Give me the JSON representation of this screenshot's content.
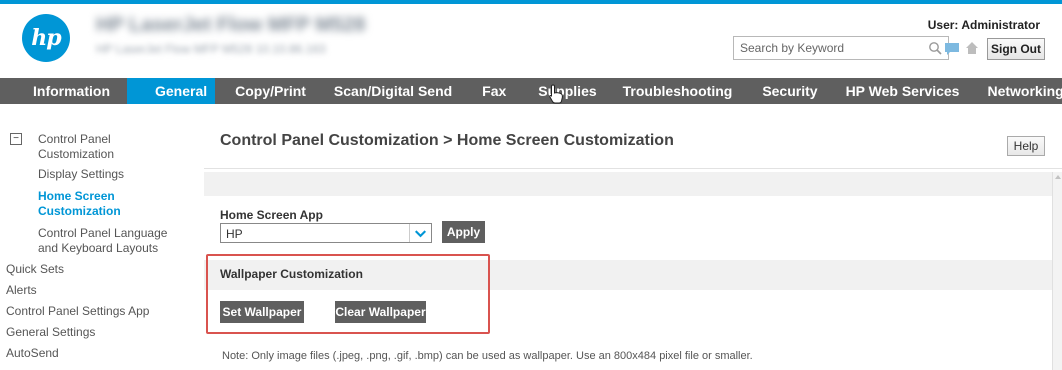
{
  "header": {
    "logo_text": "hp",
    "device_name": "HP LaserJet Flow MFP M528",
    "device_subtitle": "HP LaserJet Flow MFP M528  10.10.86.163",
    "search_placeholder": "Search by Keyword",
    "user_label": "User: Administrator",
    "sign_out_label": "Sign Out"
  },
  "nav": {
    "items": [
      {
        "label": "Information",
        "active": false
      },
      {
        "label": "General",
        "active": true
      },
      {
        "label": "Copy/Print",
        "active": false
      },
      {
        "label": "Scan/Digital Send",
        "active": false
      },
      {
        "label": "Fax",
        "active": false
      },
      {
        "label": "Supplies",
        "active": false
      },
      {
        "label": "Troubleshooting",
        "active": false
      },
      {
        "label": "Security",
        "active": false
      },
      {
        "label": "HP Web Services",
        "active": false
      },
      {
        "label": "Networking",
        "active": false
      }
    ]
  },
  "sidebar": {
    "collapse_symbol": "−",
    "items": [
      {
        "label": "Control Panel Customization"
      },
      {
        "label": "Display Settings"
      },
      {
        "label": "Home Screen Customization"
      },
      {
        "label": "Control Panel Language and Keyboard Layouts"
      },
      {
        "label": "Quick Sets"
      },
      {
        "label": "Alerts"
      },
      {
        "label": "Control Panel Settings App"
      },
      {
        "label": "General Settings"
      },
      {
        "label": "AutoSend"
      }
    ]
  },
  "main": {
    "title": "Control Panel Customization > Home Screen Customization",
    "help_label": "Help",
    "home_screen_app": {
      "label": "Home Screen App",
      "selected_value": "HP",
      "apply_label": "Apply"
    },
    "wallpaper": {
      "title": "Wallpaper Customization",
      "set_label": "Set Wallpaper",
      "clear_label": "Clear Wallpaper"
    },
    "note": "Note: Only image files (.jpeg, .png, .gif, .bmp) can be used as wallpaper. Use an 800x484 pixel file or smaller."
  },
  "colors": {
    "accent": "#0096d6",
    "nav_bg": "#5f5f5f",
    "button_bg": "#5f5f5f",
    "highlight": "#d9534f"
  }
}
